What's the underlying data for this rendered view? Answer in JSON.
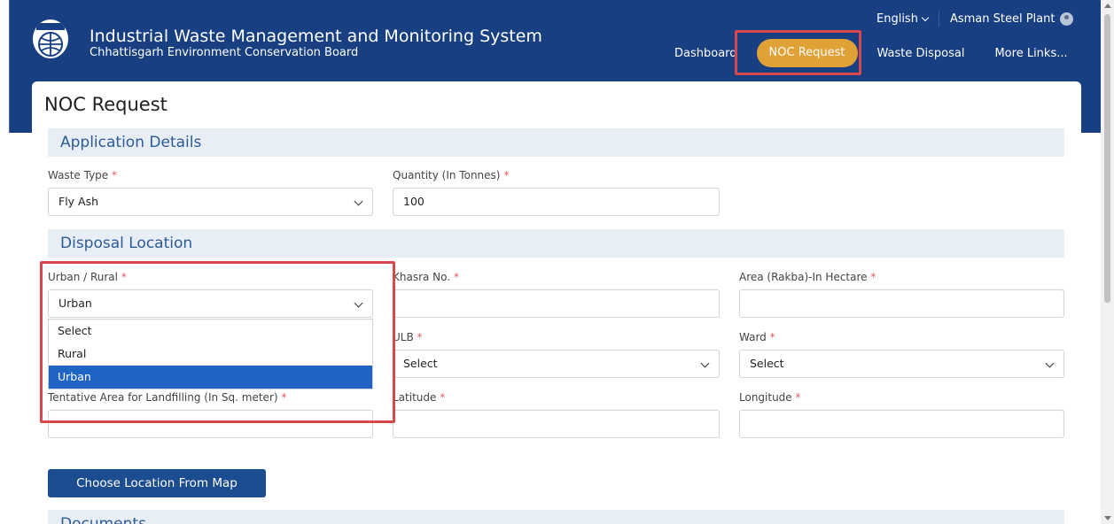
{
  "header": {
    "title": "Industrial Waste Management and Monitoring System",
    "subtitle": "Chhattisgarh Environment Conservation Board",
    "language": "English",
    "user": "Asman Steel Plant"
  },
  "nav": {
    "items": [
      "Dashboard",
      "NOC Request",
      "Waste Disposal",
      "More Links..."
    ],
    "active": "NOC Request"
  },
  "page": {
    "title": "NOC Request"
  },
  "sections": {
    "application": "Application Details",
    "disposal": "Disposal Location",
    "documents": "Documents"
  },
  "form": {
    "waste_type": {
      "label": "Waste Type",
      "value": "Fly Ash"
    },
    "quantity": {
      "label": "Quantity (In Tonnes)",
      "value": "100"
    },
    "urban_rural": {
      "label": "Urban / Rural",
      "value": "Urban",
      "options": [
        "Select",
        "Rural",
        "Urban"
      ]
    },
    "khasra": {
      "label": "Khasra No.",
      "value": ""
    },
    "area": {
      "label": "Area (Rakba)-In Hectare",
      "value": ""
    },
    "ulb": {
      "label": "ULB",
      "value": "Select"
    },
    "ward": {
      "label": "Ward",
      "value": "Select"
    },
    "tentative_area": {
      "label": "Tentative Area for Landfilling (In Sq. meter)",
      "value": ""
    },
    "latitude": {
      "label": "Latitude",
      "value": ""
    },
    "longitude": {
      "label": "Longitude",
      "value": ""
    },
    "required_mark": "*"
  },
  "buttons": {
    "choose_location": "Choose Location From Map"
  },
  "colors": {
    "header_bg": "#173f82",
    "accent_active": "#e0a136",
    "highlight_border": "#d9474e",
    "section_bg": "#e8eef6",
    "section_text": "#2e5a94",
    "button_bg": "#1c4d91",
    "selected_option": "#1f63c4"
  }
}
